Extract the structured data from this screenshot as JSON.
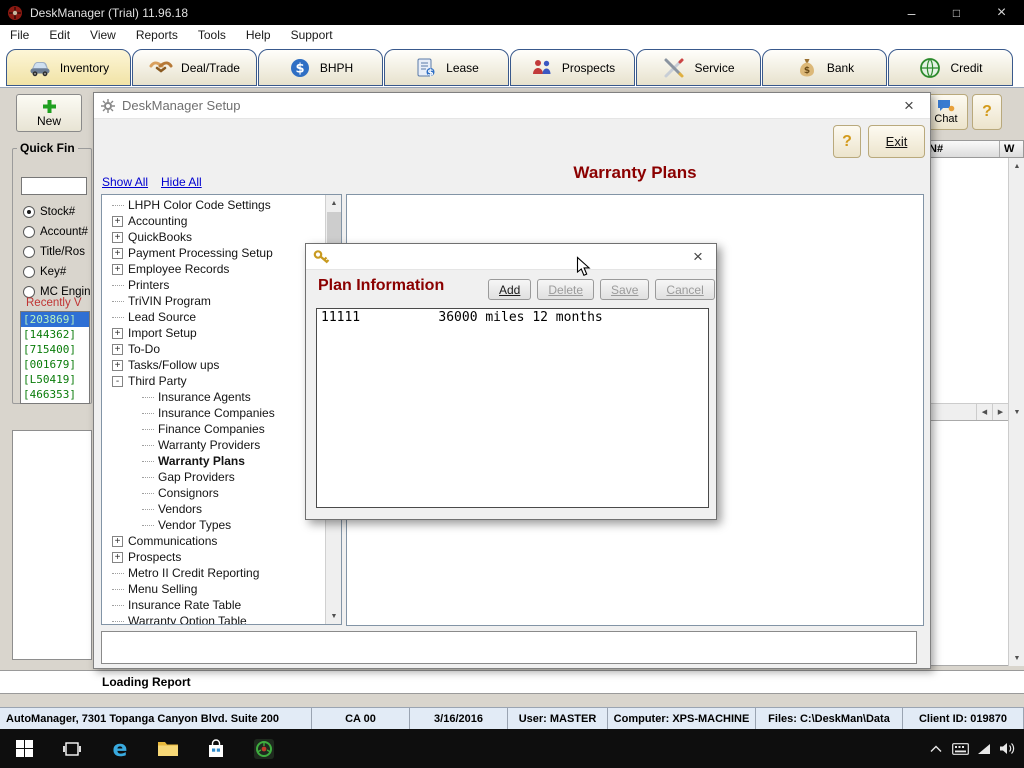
{
  "colors": {
    "accent_red": "#8b0000",
    "link_blue": "#0000d0",
    "selection_blue": "#2e6fd4",
    "recent_green": "#0a7c0a"
  },
  "titlebar": {
    "title": "DeskManager (Trial) 11.96.18",
    "controls": [
      "minimize-icon",
      "maximize-icon",
      "close-icon"
    ]
  },
  "menubar": {
    "items": [
      "File",
      "Edit",
      "View",
      "Reports",
      "Tools",
      "Help",
      "Support"
    ]
  },
  "tabs": [
    {
      "label": "Inventory",
      "icon": "car-icon",
      "active": true
    },
    {
      "label": "Deal/Trade",
      "icon": "handshake-icon",
      "active": false
    },
    {
      "label": "BHPH",
      "icon": "dollar-icon",
      "active": false
    },
    {
      "label": "Lease",
      "icon": "lease-icon",
      "active": false
    },
    {
      "label": "Prospects",
      "icon": "people-icon",
      "active": false
    },
    {
      "label": "Service",
      "icon": "tools-icon",
      "active": false
    },
    {
      "label": "Bank",
      "icon": "moneybag-icon",
      "active": false
    },
    {
      "label": "Credit",
      "icon": "globe-icon",
      "active": false
    }
  ],
  "left_panel": {
    "new_button": "New",
    "quick_find_title": "Quick Fin",
    "radios": [
      {
        "label": "Stock#",
        "selected": true
      },
      {
        "label": "Account#",
        "selected": false
      },
      {
        "label": "Title/Ros",
        "selected": false
      },
      {
        "label": "Key#",
        "selected": false
      },
      {
        "label": "MC Engin",
        "selected": false
      }
    ],
    "recently_viewed_label": "Recently V",
    "recent_items": [
      {
        "label": "[203869]",
        "selected": true
      },
      {
        "label": "[144362]",
        "selected": false
      },
      {
        "label": "[715400]",
        "selected": false
      },
      {
        "label": "[001679]",
        "selected": false
      },
      {
        "label": "[L50419]",
        "selected": false
      },
      {
        "label": "[466353]",
        "selected": false
      }
    ]
  },
  "right_panel": {
    "chat_button": "Chat",
    "help_button": "?",
    "grid_headers": [
      "N#",
      "W"
    ]
  },
  "setup_dialog": {
    "title": "DeskManager Setup",
    "help_button": "?",
    "exit_button": "Exit",
    "show_all": "Show All",
    "hide_all": "Hide All",
    "page_title": "Warranty Plans",
    "tree": [
      {
        "label": "LHPH Color Code Settings",
        "level": 0,
        "state": "none",
        "bold": false
      },
      {
        "label": "Accounting",
        "level": 0,
        "state": "plus",
        "bold": false
      },
      {
        "label": "QuickBooks",
        "level": 0,
        "state": "plus",
        "bold": false
      },
      {
        "label": "Payment Processing Setup",
        "level": 0,
        "state": "plus",
        "bold": false
      },
      {
        "label": "Employee Records",
        "level": 0,
        "state": "plus",
        "bold": false
      },
      {
        "label": "Printers",
        "level": 0,
        "state": "none",
        "bold": false
      },
      {
        "label": "TriVIN Program",
        "level": 0,
        "state": "none",
        "bold": false
      },
      {
        "label": "Lead Source",
        "level": 0,
        "state": "none",
        "bold": false
      },
      {
        "label": "Import Setup",
        "level": 0,
        "state": "plus",
        "bold": false
      },
      {
        "label": "To-Do",
        "level": 0,
        "state": "plus",
        "bold": false
      },
      {
        "label": "Tasks/Follow ups",
        "level": 0,
        "state": "plus",
        "bold": false
      },
      {
        "label": "Third Party",
        "level": 0,
        "state": "minus",
        "bold": false
      },
      {
        "label": "Insurance Agents",
        "level": 1,
        "state": "none",
        "bold": false
      },
      {
        "label": "Insurance Companies",
        "level": 1,
        "state": "none",
        "bold": false
      },
      {
        "label": "Finance Companies",
        "level": 1,
        "state": "none",
        "bold": false
      },
      {
        "label": "Warranty Providers",
        "level": 1,
        "state": "none",
        "bold": false
      },
      {
        "label": "Warranty Plans",
        "level": 1,
        "state": "none",
        "bold": true
      },
      {
        "label": "Gap Providers",
        "level": 1,
        "state": "none",
        "bold": false
      },
      {
        "label": "Consignors",
        "level": 1,
        "state": "none",
        "bold": false
      },
      {
        "label": "Vendors",
        "level": 1,
        "state": "none",
        "bold": false
      },
      {
        "label": "Vendor Types",
        "level": 1,
        "state": "none",
        "bold": false
      },
      {
        "label": "Communications",
        "level": 0,
        "state": "plus",
        "bold": false
      },
      {
        "label": "Prospects",
        "level": 0,
        "state": "plus",
        "bold": false
      },
      {
        "label": "Metro II Credit Reporting",
        "level": 0,
        "state": "none",
        "bold": false
      },
      {
        "label": "Menu Selling",
        "level": 0,
        "state": "none",
        "bold": false
      },
      {
        "label": "Insurance Rate Table",
        "level": 0,
        "state": "none",
        "bold": false
      },
      {
        "label": "Warranty Option Table",
        "level": 0,
        "state": "none",
        "bold": false
      }
    ]
  },
  "plan_dialog": {
    "title": "Plan Information",
    "buttons": [
      {
        "label": "Add",
        "enabled": true
      },
      {
        "label": "Delete",
        "enabled": false
      },
      {
        "label": "Save",
        "enabled": false
      },
      {
        "label": "Cancel",
        "enabled": false
      }
    ],
    "rows": [
      "11111          36000 miles 12 months"
    ]
  },
  "status_strip": {
    "text": "Loading Report"
  },
  "statusbar": {
    "segments": [
      "AutoManager, 7301 Topanga Canyon Blvd. Suite 200",
      "CA 00",
      "3/16/2016",
      "User: MASTER",
      "Computer: XPS-MACHINE",
      "Files: C:\\DeskMan\\Data",
      "Client ID: 019870"
    ]
  },
  "taskbar": {
    "icons": [
      "start-icon",
      "taskview-icon",
      "edge-icon",
      "folder-icon",
      "store-icon",
      "deskmanager-icon"
    ],
    "tray_icons": [
      "chevron-up-icon",
      "keyboard-icon",
      "network-icon",
      "speaker-icon"
    ]
  }
}
